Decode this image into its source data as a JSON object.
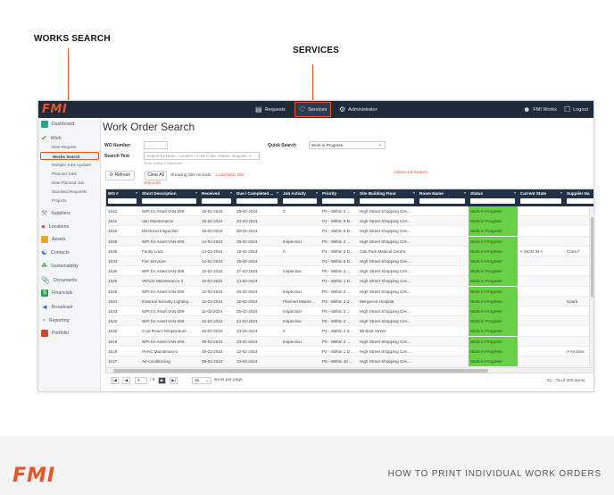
{
  "callouts": {
    "works_search": "WORKS SEARCH",
    "services": "SERVICES"
  },
  "topbar": {
    "logo": "FMI",
    "requests": "Requests",
    "services": "Services",
    "administrator": "Administrator",
    "user": "FMI Works",
    "logout": "Logout"
  },
  "sidebar": {
    "dashboard": "Dashboard",
    "work": "Work",
    "sub": [
      "New Request",
      "Works Search",
      "Multiple Jobs Updater",
      "Planned Jobs",
      "New Planned Job",
      "Standard Requests",
      "Projects"
    ],
    "suppliers": "Suppliers",
    "locations": "Locations",
    "assets": "Assets",
    "contacts": "Contacts",
    "sustainability": "Sustainability",
    "documents": "Documents",
    "financials": "Financials",
    "broadcast": "Broadcast",
    "reporting": "Reporting",
    "portfolio": "Portfolio"
  },
  "main": {
    "title": "Work Order Search",
    "wo_number_label": "WO Number",
    "search_text_label": "Search Text",
    "search_placeholder": "Search by Desc., Location, Cost Code, Status, Supplier, e",
    "hint": "Enter at least 3 characters",
    "quick_search_label": "Quick Search",
    "quick_search_value": "Work in Progress",
    "advanced_search": "Advanced Search",
    "refresh": "Refresh",
    "clear_all": "Clear All",
    "showing": "Showing 200 records.",
    "load_next": "Load Next 200",
    "records": "Records"
  },
  "grid": {
    "columns": [
      "WO #",
      "Short Description",
      "Received",
      "Due / Completed ...",
      "Job Activity",
      "Priority",
      "Site Building Floor",
      "Room Name",
      "Status",
      "Current State",
      "Supplier Na"
    ],
    "rows": [
      [
        "1542",
        "WPI for Asset:VAN-006",
        "15-02-2024",
        "29-02-2024",
        "0",
        "P5 - Within 2 ...",
        "High Street Shopping Cen...",
        "",
        "Work In Progress",
        "",
        ""
      ],
      [
        "1541",
        "Van Maintenance",
        "15-02-2024",
        "20-02-2024",
        "",
        "P4 - Within 5 D...",
        "High Street Shopping Cen...",
        "",
        "Work In Progress",
        "",
        ""
      ],
      [
        "1540",
        "Electrical Inspection",
        "15-02-2024",
        "20-02-2024",
        "",
        "P4 - Within 5 D...",
        "High Street Shopping Cen...",
        "",
        "Work In Progress",
        "",
        ""
      ],
      [
        "1539",
        "WPI for Asset:VAN-006",
        "14-02-2024",
        "28-02-2024",
        "Inspection",
        "P5 - Within 2 ...",
        "High Street Shopping Cen...",
        "",
        "Work In Progress",
        "",
        ""
      ],
      [
        "1536",
        "Faulty Lock",
        "14-02-2024",
        "19-02-2024",
        "0",
        "P4 - Within 5 D...",
        "Oak Park Medical Centre",
        "",
        "Work In Progress",
        "< SIGN IN >",
        "Chris F"
      ],
      [
        "1533",
        "Fire Services",
        "14-02-2024",
        "19-02-2024",
        "",
        "P4 - Within 5 D...",
        "High Street Shopping Cen...",
        "",
        "Work In Progress",
        "",
        ""
      ],
      [
        "1530",
        "WPI for Asset:VAN-006",
        "13-02-2024",
        "27-02-2024",
        "Inspection",
        "P5 - Within 2 ...",
        "High Street Shopping Cen...",
        "",
        "Work In Progress",
        "",
        ""
      ],
      [
        "1529",
        "Vehicle Maintenance 2",
        "13-02-2024",
        "14-02-2024",
        "",
        "P2 - Within 1 D...",
        "High Street Shopping Cen...",
        "",
        "Work In Progress",
        "",
        ""
      ],
      [
        "1525",
        "WPI for Asset:VAN-006",
        "12-02-2024",
        "26-02-2024",
        "Inspection",
        "P5 - Within 2 ...",
        "High Street Shopping Cen...",
        "",
        "Work In Progress",
        "",
        ""
      ],
      [
        "1524",
        "External Security Lighting ...",
        "12-02-2024",
        "15-02-2024",
        "Planned Mainte...",
        "P3 - Within 2 d...",
        "Mergence Hospital",
        "",
        "Work In Progress",
        "",
        "Spark"
      ],
      [
        "1523",
        "WPI for Asset:VAN-006",
        "11-02-2024",
        "25-02-2024",
        "Inspection",
        "P5 - Within 2 ...",
        "High Street Shopping Cen...",
        "",
        "Work In Progress",
        "",
        ""
      ],
      [
        "1522",
        "WPI for Asset:VAN-006",
        "10-02-2024",
        "24-02-2024",
        "Inspection",
        "P5 - Within 2 ...",
        "High Street Shopping Cen...",
        "",
        "Work In Progress",
        "",
        ""
      ],
      [
        "1520",
        "Cool Room Temperature ...",
        "10-02-2024",
        "13-02-2024",
        "0",
        "P3 - Within 2 d...",
        "88 Best Street",
        "",
        "Work In Progress",
        "",
        ""
      ],
      [
        "1519",
        "WPI for Asset:VAN-006",
        "09-02-2024",
        "23-02-2024",
        "Inspection",
        "P5 - Within 2 ...",
        "High Street Shopping Cen...",
        "",
        "Work In Progress",
        "",
        ""
      ],
      [
        "1518",
        "HVAC Maintenance",
        "09-02-2024",
        "10-02-2024",
        "",
        "P2 - Within 1 D...",
        "High Street Shopping Cen...",
        "",
        "Work In Progress",
        "",
        "A AA Elec"
      ],
      [
        "1517",
        "Air-conditioning",
        "09-02-2024",
        "10-03-2024",
        "",
        "P6 - Within 30 ...",
        "High Street Shopping Cen...",
        "",
        "Work In Progress",
        "",
        ""
      ]
    ]
  },
  "pager": {
    "page": "3",
    "of_pages": "/ 8",
    "page_size": "25",
    "items_per_page": "items per page",
    "range": "51 - 75 of 200 items"
  },
  "footer": {
    "logo": "FMI",
    "caption": "HOW TO PRINT INDIVIDUAL WORK ORDERS"
  },
  "colors": {
    "accent": "#e8542a",
    "topbar": "#1f2b3b",
    "header": "#223145",
    "status_green": "#69d145"
  }
}
